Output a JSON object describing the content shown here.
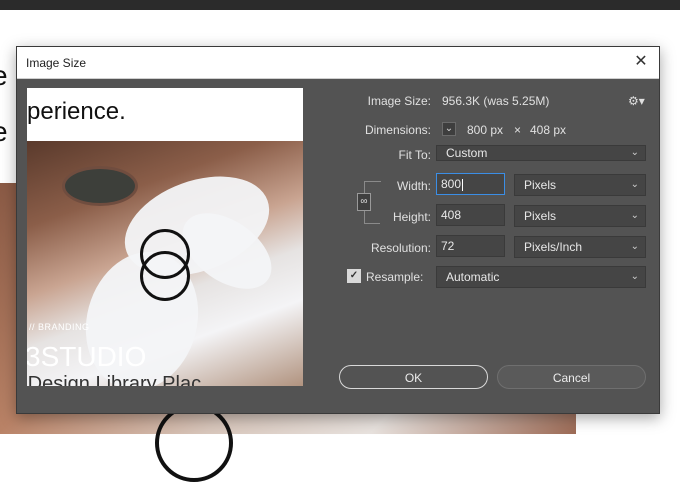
{
  "background": {
    "heading_lines": [
      "e",
      "e"
    ],
    "accent": "#2b2b2b"
  },
  "dialog": {
    "title": "Image Size",
    "close_icon": "close-icon",
    "preview": {
      "heading": "perience.",
      "small_label": "// BRANDING",
      "studio": "3STUDIO",
      "library": "·Design Library Plac"
    },
    "image_size": {
      "label": "Image Size:",
      "value": "956.3K (was 5.25M)"
    },
    "settings_icon": "gear-icon",
    "dimensions": {
      "label": "Dimensions:",
      "width": "800 px",
      "sep": "×",
      "height": "408 px",
      "expand_icon": "chevron-down-icon"
    },
    "fit_to": {
      "label": "Fit To:",
      "value": "Custom"
    },
    "width": {
      "label": "Width:",
      "value": "800",
      "unit": "Pixels"
    },
    "height": {
      "label": "Height:",
      "value": "408",
      "unit": "Pixels"
    },
    "resolution": {
      "label": "Resolution:",
      "value": "72",
      "unit": "Pixels/Inch"
    },
    "resample": {
      "label": "Resample:",
      "checked": true,
      "value": "Automatic"
    },
    "ok_label": "OK",
    "cancel_label": "Cancel",
    "colors": {
      "panel": "#535353",
      "focus": "#3b8ee6"
    }
  }
}
